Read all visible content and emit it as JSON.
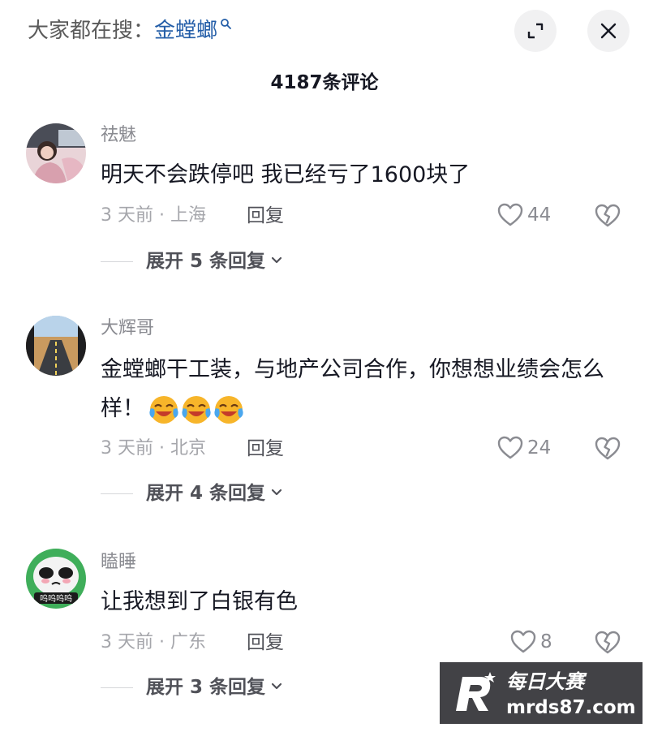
{
  "header": {
    "search_prefix": "大家都在搜：",
    "search_keyword": "金螳螂",
    "comment_count": "4187条评论"
  },
  "colors": {
    "keyword": "#245ea8",
    "background": "#ffffff",
    "meta": "#a5a6ab"
  },
  "icons": [
    "search-icon",
    "expand-icon",
    "close-icon",
    "heart-icon",
    "broken-heart-icon",
    "chevron-down-icon"
  ],
  "comments": [
    {
      "username": "祛魅",
      "text": "明天不会跌停吧 我已经亏了1600块了",
      "time_location": "3 天前 · 上海",
      "reply_label": "回复",
      "likes": "44",
      "expand_label": "展开 5 条回复"
    },
    {
      "username": "大辉哥",
      "text": "金螳螂干工装，与地产公司合作，你想想业绩会怎么样！",
      "emoji": [
        "crying-laughing-emoji",
        "crying-laughing-emoji",
        "crying-laughing-emoji"
      ],
      "time_location": "3 天前 · 北京",
      "reply_label": "回复",
      "likes": "24",
      "expand_label": "展开 4 条回复"
    },
    {
      "username": "瞌睡",
      "text": "让我想到了白银有色",
      "avatar_caption": "呜呜呜呜",
      "time_location": "3 天前 · 广东",
      "reply_label": "回复",
      "likes": "8",
      "expand_label": "展开 3 条回复"
    }
  ],
  "watermark": {
    "name": "每日大赛",
    "url": "mrds87.com"
  }
}
